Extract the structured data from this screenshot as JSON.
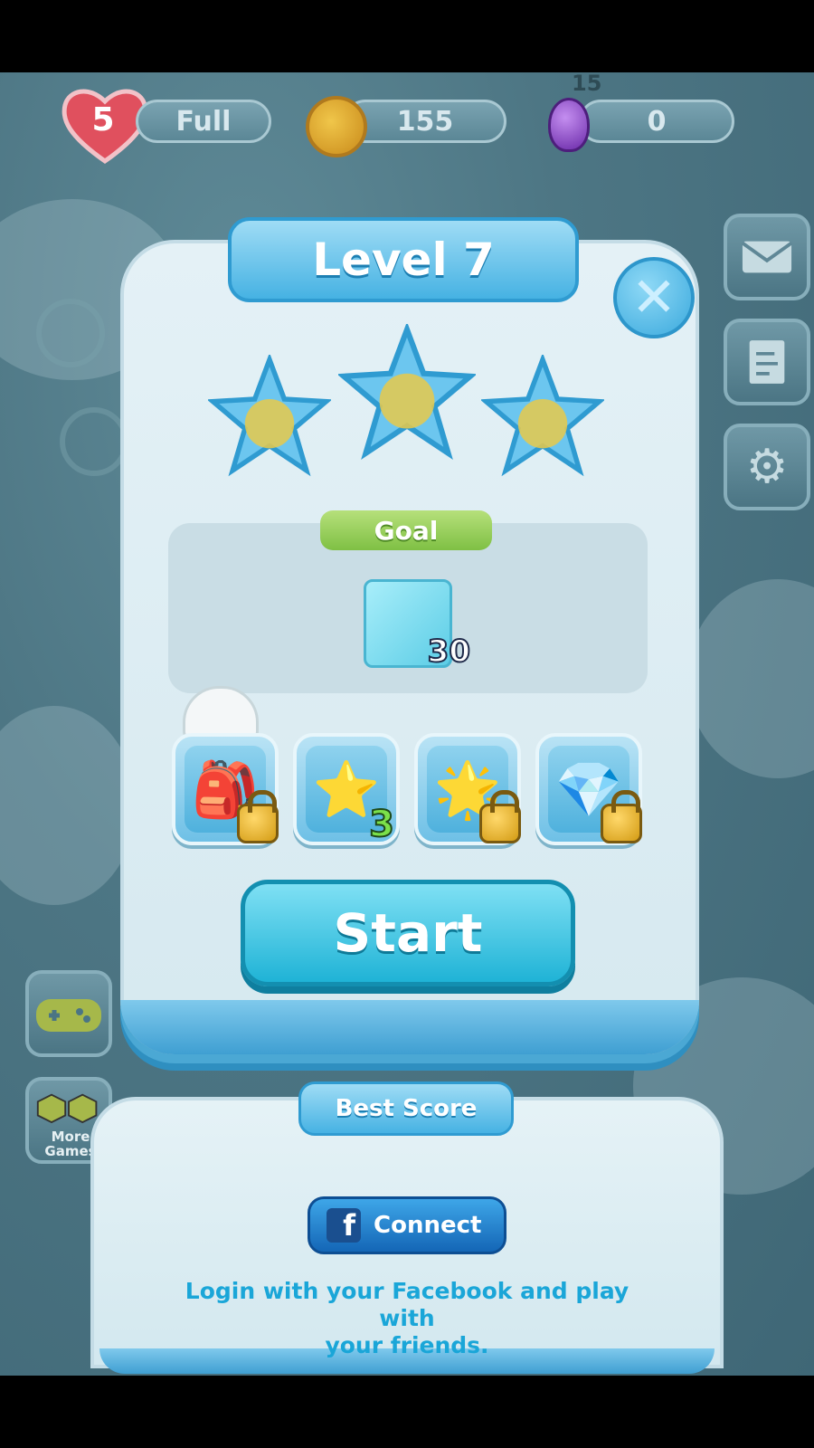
{
  "topbar": {
    "lives": "5",
    "lives_status": "Full",
    "coins": "155",
    "gems": "0",
    "badge_count": "15"
  },
  "side_buttons": {
    "mail_icon": "envelope-icon",
    "map_icon": "map-icon",
    "settings_icon": "gear-icon"
  },
  "left_buttons": {
    "games_icon": "gamepad-icon",
    "more_games_label": "More Games"
  },
  "level_panel": {
    "title": "Level 7",
    "stars_count": 3,
    "goal_label": "Goal",
    "goal_target": "30",
    "goal_icon": "ice-block-icon",
    "boosters": [
      {
        "icon": "bag-icon",
        "locked": true,
        "count": ""
      },
      {
        "icon": "rainbow-star-icon",
        "locked": false,
        "count": "3"
      },
      {
        "icon": "multicolor-star-icon",
        "locked": true,
        "count": ""
      },
      {
        "icon": "paw-crystal-icon",
        "locked": true,
        "count": ""
      }
    ],
    "start_label": "Start"
  },
  "best_score": {
    "title": "Best Score",
    "connect_label": "Connect",
    "login_text_line1": "Login with your Facebook and play with",
    "login_text_line2": "your friends."
  },
  "colors": {
    "accent": "#1fb3d6",
    "goal_green": "#7fc044",
    "facebook_blue": "#1466b6",
    "login_text": "#1aa6d8"
  }
}
